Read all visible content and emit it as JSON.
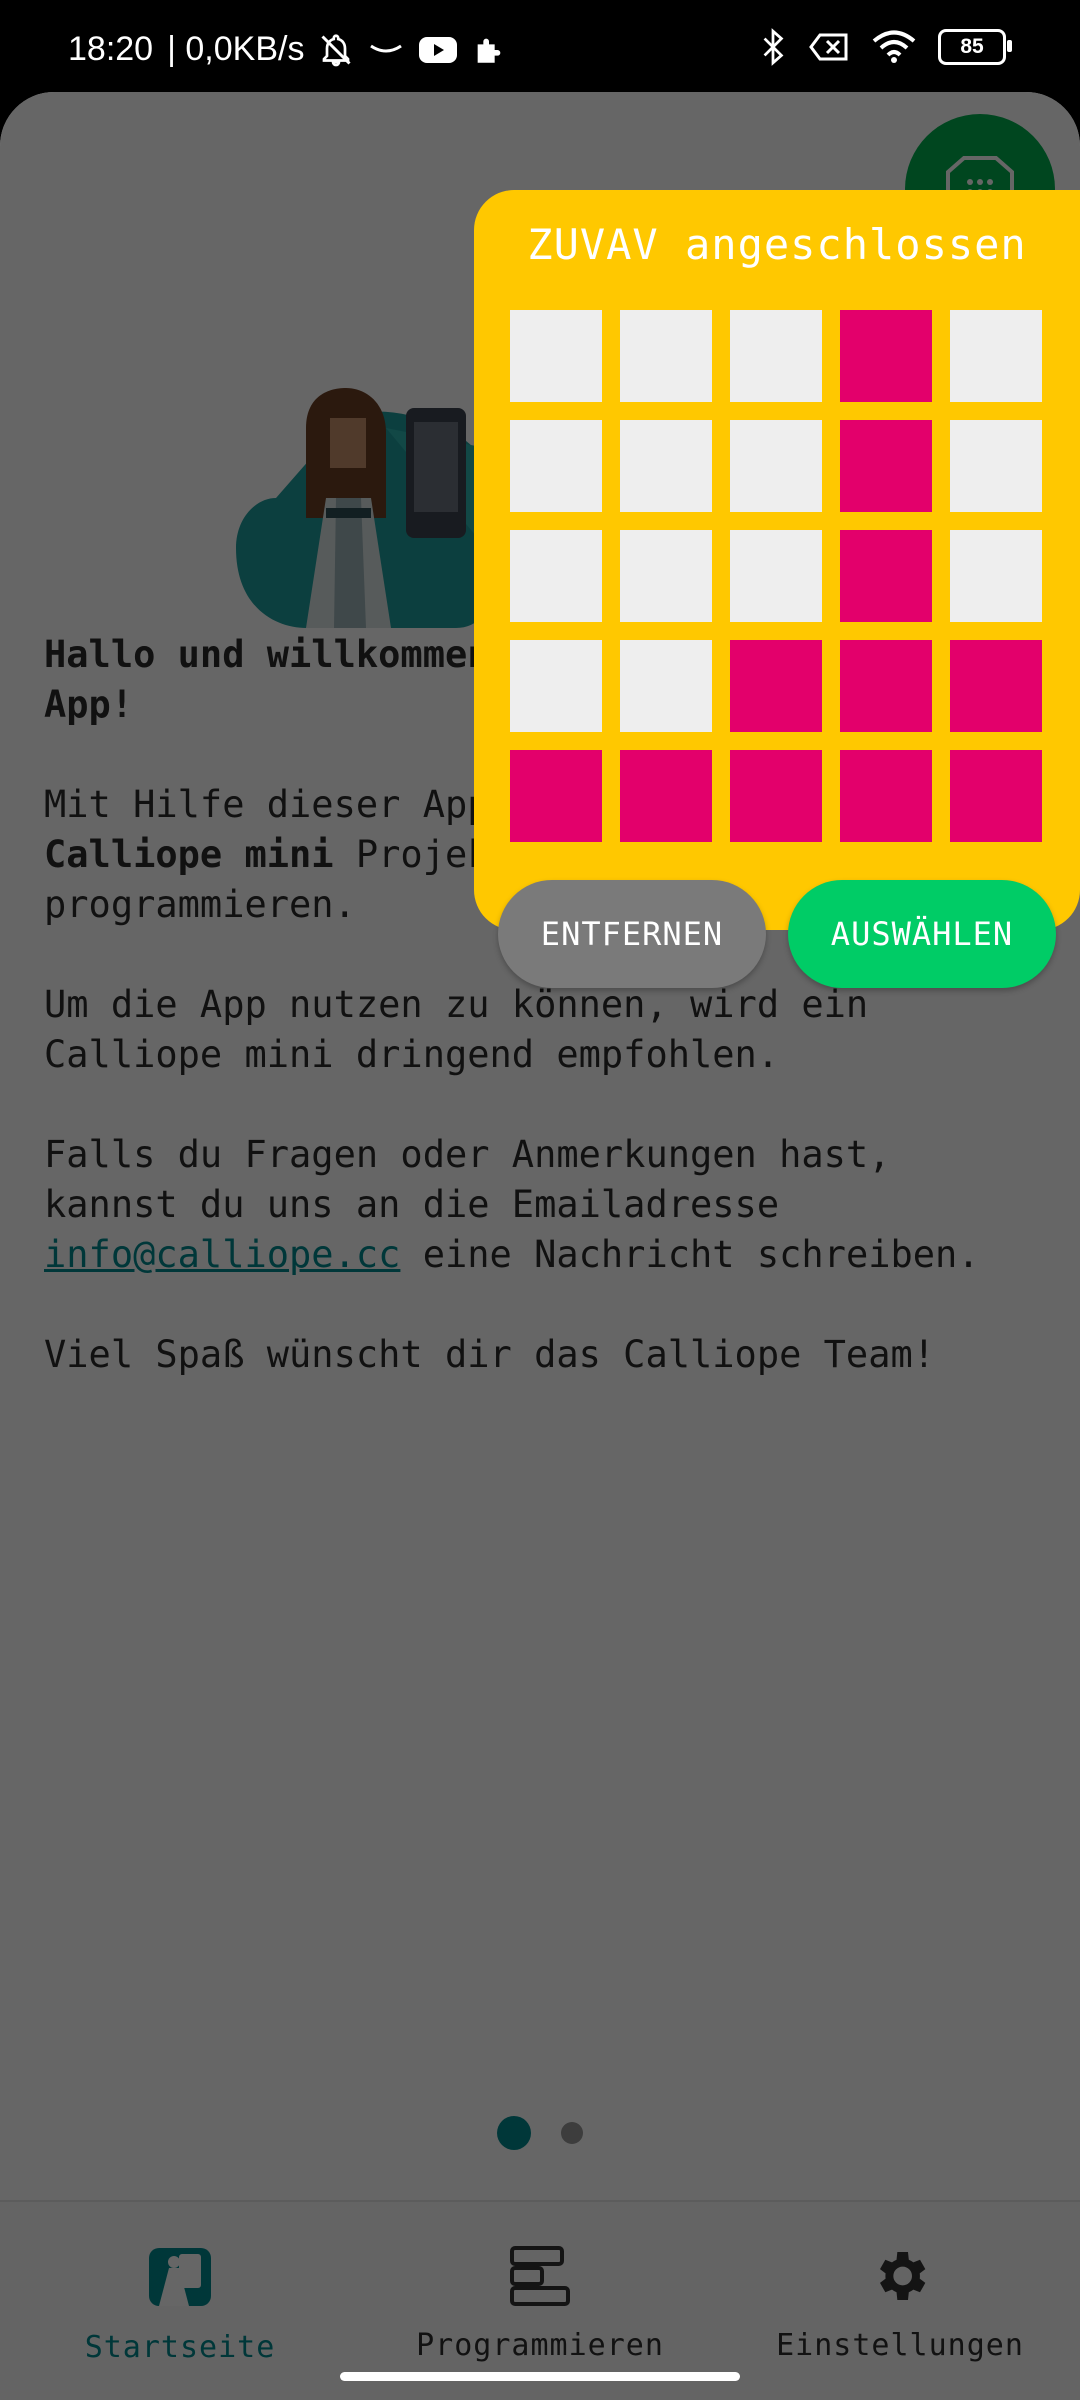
{
  "status_bar": {
    "time": "18:20",
    "network_speed": "| 0,0KB/s",
    "battery": "85",
    "icons": [
      "bell-off-icon",
      "amazon-icon",
      "youtube-icon",
      "puzzle-icon",
      "bluetooth-icon",
      "no-sim-icon",
      "wifi-icon",
      "battery-icon"
    ]
  },
  "welcome": {
    "greeting": "Hallo und willkommen in der Calliope mini App!",
    "intro_before": "Mit Hilfe dieser App kannst du mit deinem ",
    "intro_bold": "Calliope mini",
    "intro_after": " Projekte direkt mobil programmieren.",
    "recommendation": "Um die App nutzen zu können, wird ein Calliope mini dringend empfohlen.",
    "contact_before": "Falls du Fragen oder Anmerkungen hast, kannst du uns an die Emailadresse ",
    "contact_email": "info@calliope.cc",
    "contact_after": " eine Nachricht schreiben.",
    "signoff": "Viel Spaß wünscht dir das Calliope Team!"
  },
  "pager": {
    "pages": 2,
    "active_index": 0
  },
  "bottom_nav": {
    "items": [
      {
        "label": "Startseite",
        "icon": "home-calliope-icon",
        "active": true
      },
      {
        "label": "Programmieren",
        "icon": "blocks-icon",
        "active": false
      },
      {
        "label": "Einstellungen",
        "icon": "gear-icon",
        "active": false
      }
    ]
  },
  "device_popup": {
    "title": "ZUVAV angeschlossen",
    "led_matrix": [
      [
        0,
        0,
        0,
        1,
        0
      ],
      [
        0,
        0,
        0,
        1,
        0
      ],
      [
        0,
        0,
        0,
        1,
        0
      ],
      [
        0,
        0,
        1,
        1,
        1
      ],
      [
        1,
        1,
        1,
        1,
        1
      ]
    ],
    "remove_label": "ENTFERNEN",
    "select_label": "AUSWÄHLEN"
  },
  "colors": {
    "accent": "#008b8f",
    "popup_bg": "#ffc800",
    "led_on": "#e3006b",
    "led_off": "#eeeeee",
    "select_button": "#00cc66",
    "remove_button": "#7a7a7a",
    "fab": "#00b04f"
  }
}
